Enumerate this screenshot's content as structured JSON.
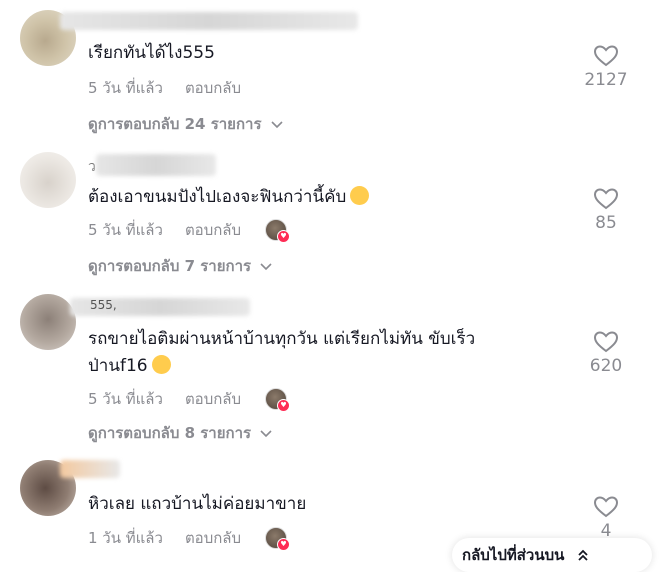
{
  "comments": [
    {
      "text": "เรียกทันได้ไง555",
      "date": "5 วัน ที่แล้ว",
      "reply_label": "ตอบกลับ",
      "likes": "2127",
      "view_replies": "ดูการตอบกลับ 24 รายการ",
      "creator_liked": false
    },
    {
      "username_visible": "ว",
      "text": "ต้องเอาขนมปังไปเองจะฟินกว่านี้คับ",
      "date": "5 วัน ที่แล้ว",
      "reply_label": "ตอบกลับ",
      "likes": "85",
      "view_replies": "ดูการตอบกลับ 7 รายการ",
      "creator_liked": true
    },
    {
      "username_visible": "555,",
      "text_line1": "รถขายไอติมผ่านหน้าบ้านทุกวัน แต่เรียกไม่ทัน ขับเร็ว",
      "text_line2": "ป่านf16",
      "date": "5 วัน ที่แล้ว",
      "reply_label": "ตอบกลับ",
      "likes": "620",
      "view_replies": "ดูการตอบกลับ 8 รายการ",
      "creator_liked": true
    },
    {
      "text": "หิวเลย แถวบ้านไม่ค่อยมาขาย",
      "date": "1 วัน ที่แล้ว",
      "reply_label": "ตอบกลับ",
      "likes": "4",
      "creator_liked": true
    }
  ],
  "back_to_top_label": "กลับไปที่ส่วนบน",
  "icons": {
    "like": "heart-outline-icon",
    "expand": "chevron-down-icon",
    "back_to_top": "double-chevron-up-icon",
    "creator_liked_badge": "heart-badge-icon"
  },
  "colors": {
    "text": "#161823",
    "secondary": "#8a8b91",
    "accent": "#fe2c55"
  }
}
